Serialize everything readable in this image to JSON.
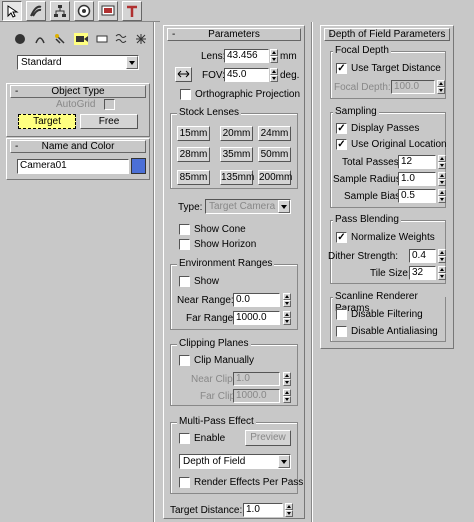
{
  "tabs": [
    {
      "name": "create-tab-icon",
      "active": true
    },
    {
      "name": "modify-tab-icon",
      "active": false
    },
    {
      "name": "hierarchy-tab-icon",
      "active": false
    },
    {
      "name": "motion-tab-icon",
      "active": false
    },
    {
      "name": "display-tab-icon",
      "active": false
    },
    {
      "name": "utilities-tab-icon",
      "active": false
    }
  ],
  "category_dropdown": "Standard",
  "object_type": {
    "title": "Object Type",
    "autogrid": "AutoGrid",
    "target_btn": "Target",
    "free_btn": "Free"
  },
  "name_color": {
    "title": "Name and Color",
    "name_value": "Camera01",
    "swatch_color": "#4b6fd6"
  },
  "parameters": {
    "title": "Parameters",
    "lens_label": "Lens:",
    "lens_value": "43.456",
    "lens_unit": "mm",
    "fov_label": "FOV:",
    "fov_value": "45.0",
    "fov_unit": "deg.",
    "ortho": "Orthographic Projection",
    "stock_title": "Stock Lenses",
    "lenses": [
      "15mm",
      "20mm",
      "24mm",
      "28mm",
      "35mm",
      "50mm",
      "85mm",
      "135mm",
      "200mm"
    ],
    "type_label": "Type:",
    "type_value": "Target Camera",
    "show_cone": "Show Cone",
    "show_horizon": "Show Horizon",
    "env_title": "Environment Ranges",
    "env_show": "Show",
    "near_range_label": "Near Range:",
    "near_range_value": "0.0",
    "far_range_label": "Far Range:",
    "far_range_value": "1000.0",
    "clip_title": "Clipping Planes",
    "clip_manually": "Clip Manually",
    "near_clip_label": "Near Clip:",
    "near_clip_value": "1.0",
    "far_clip_label": "Far Clip:",
    "far_clip_value": "1000.0",
    "multipass_title": "Multi-Pass Effect",
    "enable": "Enable",
    "preview": "Preview",
    "effect_value": "Depth of Field",
    "render_per_pass": "Render Effects Per Pass",
    "target_distance_label": "Target Distance:",
    "target_distance_value": "1.0"
  },
  "dof": {
    "title": "Depth of Field Parameters",
    "focal_title": "Focal Depth",
    "use_target": "Use Target Distance",
    "focal_depth_label": "Focal Depth:",
    "focal_depth_value": "100.0",
    "sampling_title": "Sampling",
    "display_passes": "Display Passes",
    "use_original": "Use Original Location",
    "total_passes_label": "Total Passes:",
    "total_passes_value": "12",
    "sample_radius_label": "Sample Radius:",
    "sample_radius_value": "1.0",
    "sample_bias_label": "Sample Bias:",
    "sample_bias_value": "0.5",
    "blend_title": "Pass Blending",
    "normalize": "Normalize Weights",
    "dither_label": "Dither Strength:",
    "dither_value": "0.4",
    "tile_label": "Tile Size:",
    "tile_value": "32",
    "scanline_title": "Scanline Renderer Params",
    "disable_filtering": "Disable Filtering",
    "disable_aa": "Disable Antialiasing"
  }
}
